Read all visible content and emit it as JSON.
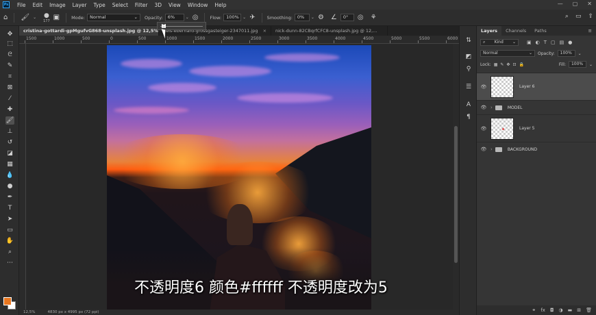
{
  "menu": [
    "File",
    "Edit",
    "Image",
    "Layer",
    "Type",
    "Select",
    "Filter",
    "3D",
    "View",
    "Window",
    "Help"
  ],
  "window_controls": [
    "—",
    "▢",
    "✕"
  ],
  "options_bar": {
    "brush_size": "177",
    "mode_label": "Mode:",
    "mode_value": "Normal",
    "opacity_label": "Opacity:",
    "opacity_value": "6%",
    "flow_label": "Flow:",
    "flow_value": "100%",
    "smoothing_label": "Smoothing:",
    "smoothing_value": "0%",
    "angle_value": "0°"
  },
  "tabs": [
    {
      "label": "cristina-gottardi-gpMgufvG868-unsplash.jpg @ 12,5% (La",
      "active": true
    },
    {
      "label": "nels-eberhard-grossgasteiger-2347011.jpg",
      "active": false
    },
    {
      "label": "nick-dunn-82CBqrfCFC8-unsplash.jpg @ 12,...",
      "active": false
    }
  ],
  "ruler_labels": [
    "1500",
    "1000",
    "500",
    "0",
    "500",
    "1000",
    "1500",
    "2000",
    "2500",
    "3000",
    "3500",
    "4000",
    "4500",
    "5000",
    "5500",
    "6000"
  ],
  "status": {
    "zoom": "12,5%",
    "doc_size": "4830 px x 4995 px (72 ppi)"
  },
  "caption": "不透明度6 颜色#ffffff 不透明度改为5",
  "colors": {
    "foreground": "#e8761f",
    "background": "#ffffff"
  },
  "layers_panel": {
    "tabs": [
      "Layers",
      "Channels",
      "Paths"
    ],
    "kind_label": "Kind",
    "blend_mode": "Normal",
    "opacity_label": "Opacity:",
    "opacity_value": "100%",
    "lock_label": "Lock:",
    "fill_label": "Fill:",
    "fill_value": "100%",
    "layers": [
      {
        "name": "Layer 6",
        "type": "layer",
        "selected": true
      },
      {
        "name": "MODEL",
        "type": "group",
        "selected": false
      },
      {
        "name": "Layer 5",
        "type": "layer",
        "selected": false
      },
      {
        "name": "BACKGROUND",
        "type": "group",
        "selected": false
      }
    ],
    "footer_icons": [
      "link-icon",
      "fx-icon",
      "mask-icon",
      "adjustment-icon",
      "group-icon",
      "new-layer-icon",
      "trash-icon"
    ]
  }
}
